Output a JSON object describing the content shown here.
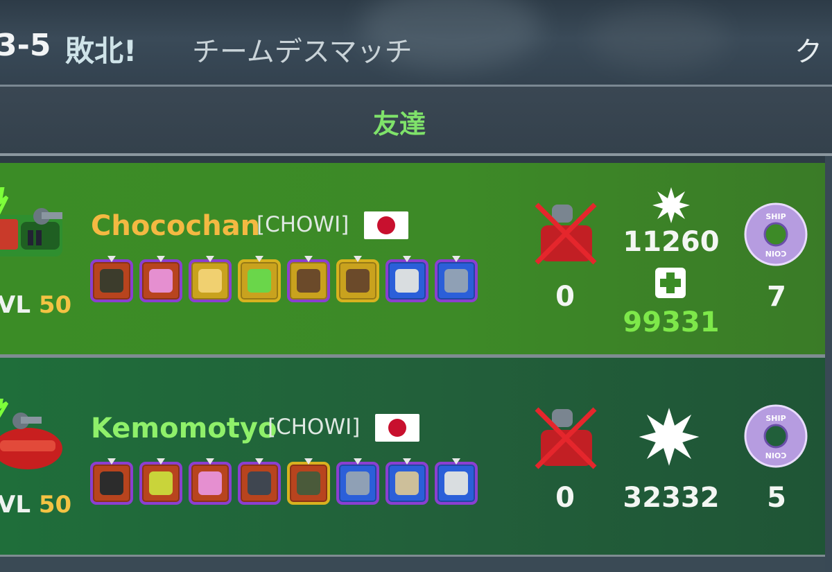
{
  "header": {
    "score": "3-5",
    "result": "敗北!",
    "mode": "チームデスマッチ",
    "cutoff_text": "ク"
  },
  "tabs": {
    "friends": "友達"
  },
  "players": [
    {
      "name": "Chocochan",
      "clan": "[CHOWI]",
      "flag": "japan-flag",
      "level_label": "VL",
      "level": "50",
      "name_color": "#f4b942",
      "items": [
        {
          "icon": "mine-icon",
          "rarity": "epic",
          "bg": "#b8441e"
        },
        {
          "icon": "energy-gun-icon",
          "rarity": "epic",
          "bg": "#b8441e"
        },
        {
          "icon": "jar-icon",
          "rarity": "epic",
          "bg": "#c9a21e"
        },
        {
          "icon": "green-launcher-icon",
          "rarity": "legendary",
          "bg": "#c9a21e"
        },
        {
          "icon": "plasma-cannon-icon",
          "rarity": "epic",
          "bg": "#c9a21e"
        },
        {
          "icon": "plasma-cannon-icon",
          "rarity": "legendary",
          "bg": "#c9a21e"
        },
        {
          "icon": "turret-icon",
          "rarity": "epic",
          "bg": "#2b5fd9"
        },
        {
          "icon": "shield-icon",
          "rarity": "epic",
          "bg": "#2b5fd9"
        }
      ],
      "deaths": "0",
      "damage": "11260",
      "healing": "99331",
      "coins": "7"
    },
    {
      "name": "Kemomotyo",
      "clan": "[CHOWI]",
      "flag": "japan-flag",
      "level_label": "VL",
      "level": "50",
      "name_color": "#8ff06a",
      "items": [
        {
          "icon": "cannon-icon",
          "rarity": "epic",
          "bg": "#b8441e"
        },
        {
          "icon": "rocket-launcher-icon",
          "rarity": "epic",
          "bg": "#b8441e"
        },
        {
          "icon": "energy-gun-icon",
          "rarity": "epic",
          "bg": "#b8441e"
        },
        {
          "icon": "gatling-icon",
          "rarity": "epic",
          "bg": "#b8441e"
        },
        {
          "icon": "armor-icon",
          "rarity": "legendary",
          "bg": "#b8441e"
        },
        {
          "icon": "shield-icon",
          "rarity": "epic",
          "bg": "#2b5fd9"
        },
        {
          "icon": "armor-plate-icon",
          "rarity": "epic",
          "bg": "#2b5fd9"
        },
        {
          "icon": "turret-icon",
          "rarity": "epic",
          "bg": "#2b5fd9"
        }
      ],
      "deaths": "0",
      "damage": "32332",
      "coins": "5"
    }
  ],
  "coin_label": "SHIP COIN"
}
